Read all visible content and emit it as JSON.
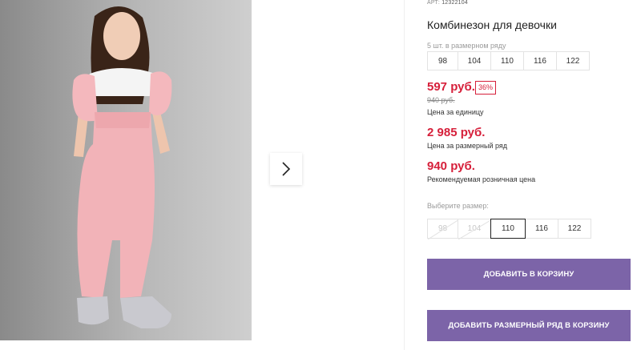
{
  "gallery": {
    "photo_alt": "Комбинезон для девочки",
    "next_icon": "chevron-right-icon"
  },
  "product": {
    "sku_label": "АРТ:",
    "sku_value": "12322104",
    "title": "Комбинезон для девочки",
    "pack_note": "5 шт. в размерном ряду",
    "pack_sizes": [
      "98",
      "104",
      "110",
      "116",
      "122"
    ],
    "price": "597 руб.",
    "discount": "36%",
    "old_price": "940 руб.",
    "unit_price_label": "Цена за единицу",
    "range_price": "2 985 руб.",
    "range_price_label": "Цена за размерный ряд",
    "rrp_price": "940 руб.",
    "rrp_label": "Рекомендуемая розничная цена"
  },
  "size_selector": {
    "label": "Выберите размер:",
    "options": [
      {
        "size": "98",
        "state": "unavailable"
      },
      {
        "size": "104",
        "state": "unavailable"
      },
      {
        "size": "110",
        "state": "selected"
      },
      {
        "size": "116",
        "state": "available"
      },
      {
        "size": "122",
        "state": "available"
      }
    ]
  },
  "actions": {
    "add_to_cart": "ДОБАВИТЬ В КОРЗИНУ",
    "add_range_to_cart": "ДОБАВИТЬ РАЗМЕРНЫЙ РЯД В КОРЗИНУ"
  },
  "colors": {
    "price_red": "#d61f3a",
    "button_purple": "#7c64a8",
    "overalls_pink": "#f2b3b8"
  }
}
